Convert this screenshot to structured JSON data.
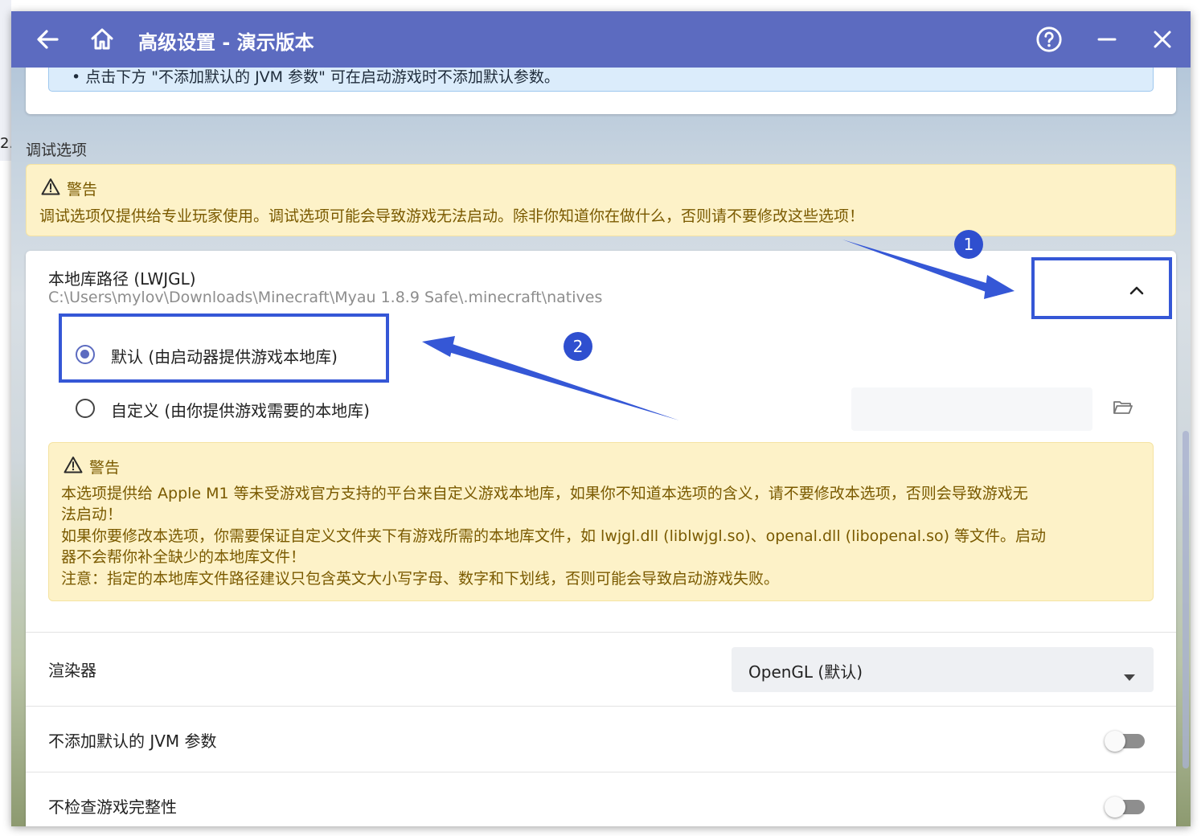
{
  "desktop": {
    "partial_number": "2."
  },
  "window": {
    "title": "高级设置 - 演示版本",
    "icons": {
      "back": "arrow-left-icon",
      "home": "home-icon",
      "help": "help-circle-icon",
      "minimize": "minimize-icon",
      "close": "close-icon"
    }
  },
  "top_info": {
    "text": "• 点击下方 \"不添加默认的 JVM 参数\" 可在启动游戏时不添加默认参数。"
  },
  "debug_section": {
    "label": "调试选项",
    "warning": {
      "title": "警告",
      "text": "调试选项仅提供给专业玩家使用。调试选项可能会导致游戏无法启动。除非你知道你在做什么，否则请不要修改这些选项！"
    }
  },
  "native_library": {
    "title": "本地库路径 (LWJGL)",
    "path": "C:\\Users\\mylov\\Downloads\\Minecraft\\Myau 1.8.9 Safe\\.minecraft\\natives",
    "options": [
      {
        "label": "默认 (由启动器提供游戏本地库)",
        "selected": true
      },
      {
        "label": "自定义 (由你提供游戏需要的本地库)",
        "selected": false
      }
    ],
    "custom_path_value": "",
    "warning": {
      "title": "警告",
      "lines": [
        "本选项提供给 Apple M1 等未受游戏官方支持的平台来自定义游戏本地库，如果你不知道本选项的含义，请不要修改本选项，否则会导致游戏无",
        "法启动！",
        "如果你要修改本选项，你需要保证自定义文件夹下有游戏所需的本地库文件，如 lwjgl.dll (liblwjgl.so)、openal.dll (libopenal.so) 等文件。启动",
        "器不会帮你补全缺少的本地库文件！",
        "注意：指定的本地库文件路径建议只包含英文大小写字母、数字和下划线，否则可能会导致启动游戏失败。"
      ]
    }
  },
  "renderer": {
    "label": "渲染器",
    "value": "OpenGL (默认)"
  },
  "toggles": [
    {
      "label": "不添加默认的 JVM 参数",
      "on": false
    },
    {
      "label": "不检查游戏完整性",
      "on": false
    }
  ],
  "annotations": {
    "badge_1": "1",
    "badge_2": "2"
  },
  "colors": {
    "accent": "#5c6bc0",
    "annotation": "#3557d6",
    "warning_bg": "#fdf2c8",
    "warning_text": "#7a5a00"
  }
}
